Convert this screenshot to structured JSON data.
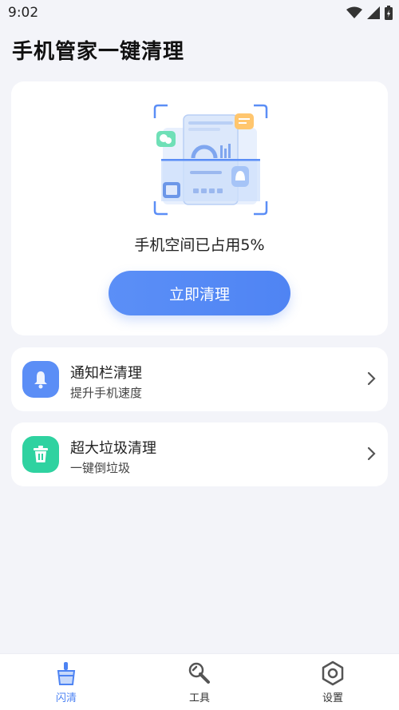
{
  "status_bar": {
    "time": "9:02"
  },
  "header": {
    "title": "手机管家一键清理"
  },
  "hero": {
    "storage_text": "手机空间已占用5%",
    "storage_percent": 5,
    "clean_button_label": "立即清理"
  },
  "features": [
    {
      "title": "通知栏清理",
      "subtitle": "提升手机速度",
      "icon": "bell-icon",
      "color": "#5b8ef6"
    },
    {
      "title": "超大垃圾清理",
      "subtitle": "一键倒垃圾",
      "icon": "trash-icon",
      "color": "#2fd2a0"
    }
  ],
  "bottom_nav": {
    "items": [
      {
        "label": "闪清",
        "icon": "broom-icon",
        "active": true
      },
      {
        "label": "工具",
        "icon": "wrench-icon",
        "active": false
      },
      {
        "label": "设置",
        "icon": "gear-icon",
        "active": false
      }
    ]
  },
  "colors": {
    "accent": "#4f84f3",
    "background": "#f3f4f9",
    "green": "#2fd2a0"
  }
}
